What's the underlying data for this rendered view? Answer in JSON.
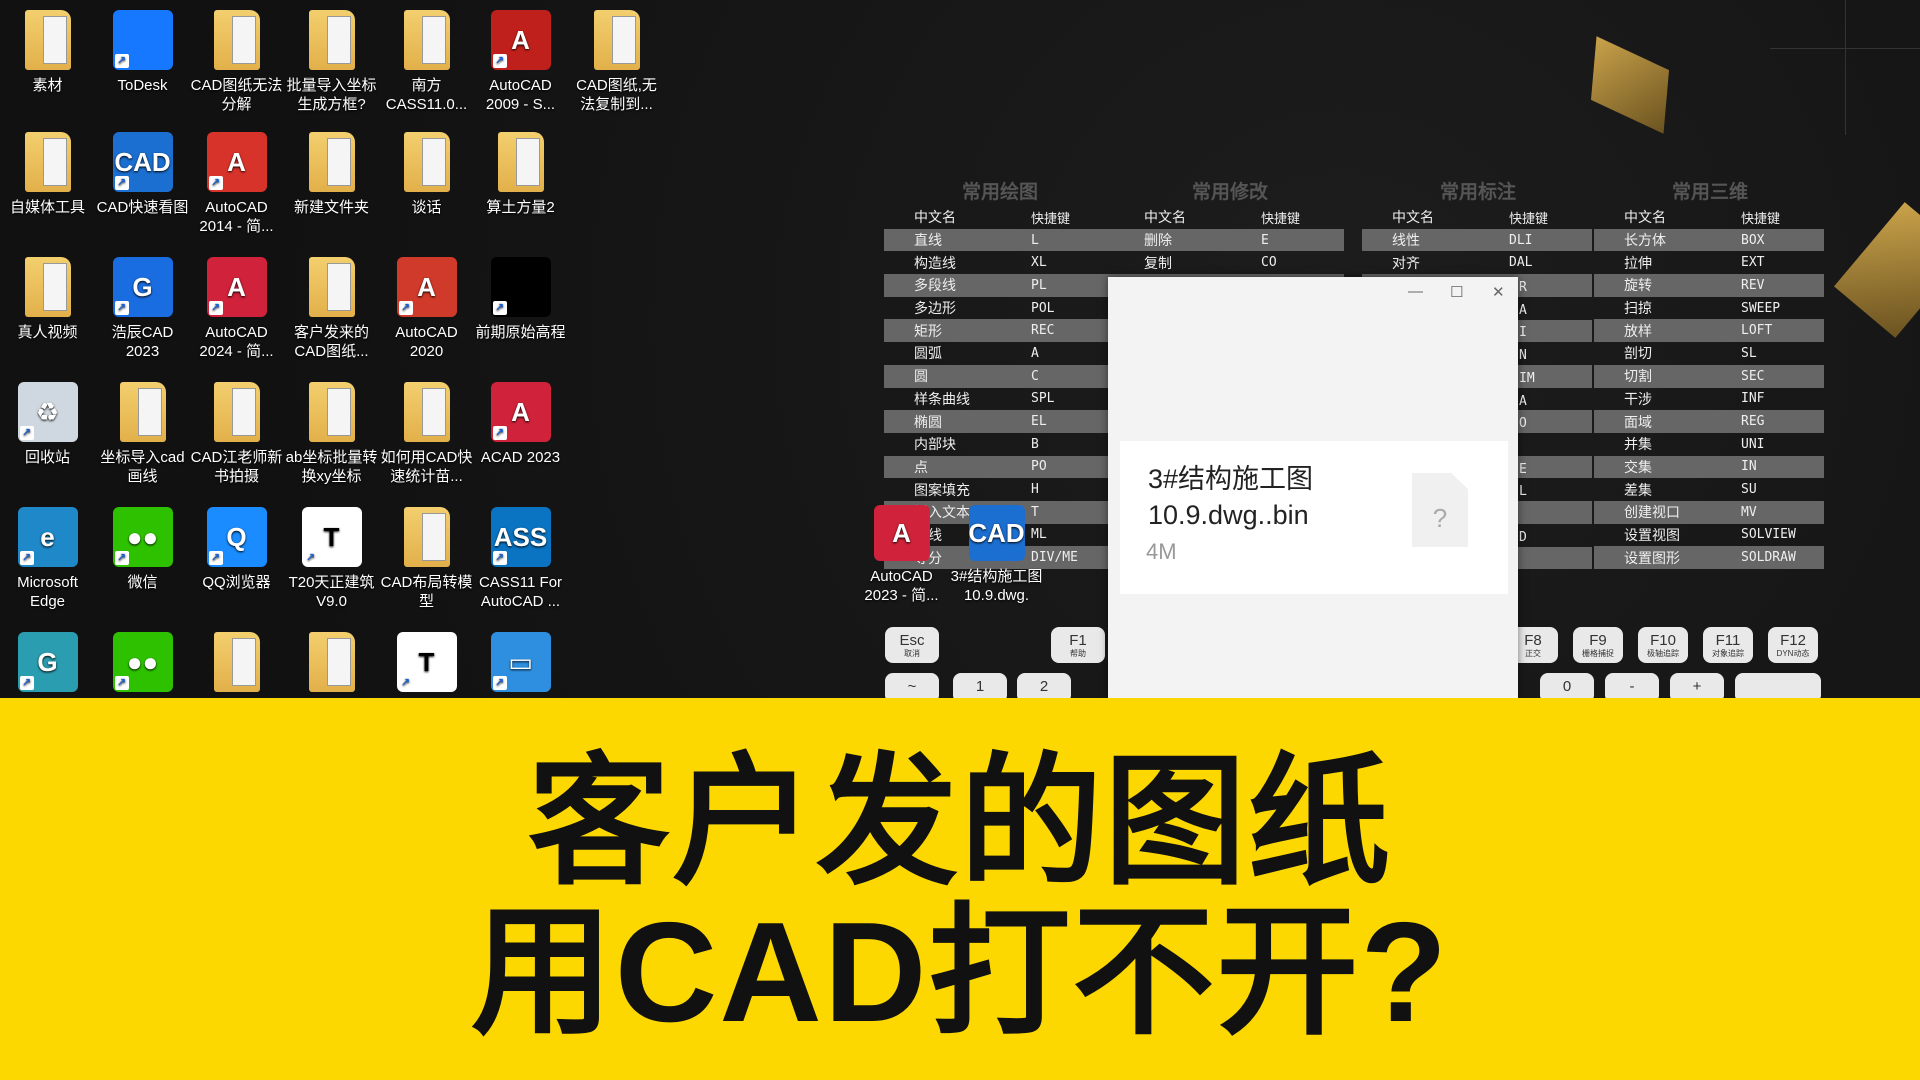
{
  "desktop_icons": [
    {
      "label": "素材",
      "type": "folder"
    },
    {
      "label": "ToDesk",
      "type": "app",
      "color": "#1677ff"
    },
    {
      "label": "CAD图纸无法分解",
      "type": "folder"
    },
    {
      "label": "批量导入坐标生成方框?",
      "type": "folder"
    },
    {
      "label": "南方CASS11.0...",
      "type": "folder"
    },
    {
      "label": "AutoCAD 2009 - S...",
      "type": "app",
      "color": "#c0201c",
      "glyph": "A"
    },
    {
      "label": "CAD图纸,无法复制到...",
      "type": "folder"
    },
    {
      "label": "自媒体工具",
      "type": "folder"
    },
    {
      "label": "CAD快速看图",
      "type": "app",
      "color": "#1b6fd1",
      "glyph": "CAD"
    },
    {
      "label": "AutoCAD 2014 - 简...",
      "type": "app",
      "color": "#d8332a",
      "glyph": "A"
    },
    {
      "label": "新建文件夹",
      "type": "folder"
    },
    {
      "label": "谈话",
      "type": "folder"
    },
    {
      "label": "算土方量2",
      "type": "folder"
    },
    {
      "label": "真人视频",
      "type": "folder"
    },
    {
      "label": "浩辰CAD 2023",
      "type": "app",
      "color": "#1a6de0",
      "glyph": "G"
    },
    {
      "label": "AutoCAD 2024 - 简...",
      "type": "app",
      "color": "#d0223a",
      "glyph": "A"
    },
    {
      "label": "客户发来的CAD图纸...",
      "type": "folder"
    },
    {
      "label": "AutoCAD 2020",
      "type": "app",
      "color": "#d03a2a",
      "glyph": "A"
    },
    {
      "label": "前期原始高程",
      "type": "app",
      "color": "#000",
      "glyph": ""
    },
    {
      "label": "回收站",
      "type": "app",
      "color": "#cfd8e0",
      "glyph": "♻"
    },
    {
      "label": "坐标导入cad画线",
      "type": "folder"
    },
    {
      "label": "CAD江老师新书拍摄",
      "type": "folder"
    },
    {
      "label": "ab坐标批量转换xy坐标",
      "type": "folder"
    },
    {
      "label": "如何用CAD快速统计苗...",
      "type": "folder"
    },
    {
      "label": "ACAD 2023",
      "type": "app",
      "color": "#d0223a",
      "glyph": "A"
    },
    {
      "label": "Microsoft Edge",
      "type": "app",
      "color": "#1e88c8",
      "glyph": "e"
    },
    {
      "label": "微信",
      "type": "app",
      "color": "#2dc100",
      "glyph": "●●"
    },
    {
      "label": "QQ浏览器",
      "type": "app",
      "color": "#1a8cff",
      "glyph": "Q"
    },
    {
      "label": "T20天正建筑V9.0",
      "type": "app",
      "color": "#fff",
      "glyph": "T"
    },
    {
      "label": "CAD布局转模型",
      "type": "folder"
    },
    {
      "label": "CASS11 For AutoCAD ...",
      "type": "app",
      "color": "#0a74c2",
      "glyph": "ASS"
    },
    {
      "label": "",
      "type": "app",
      "color": "#2a9db0",
      "glyph": "G"
    },
    {
      "label": "",
      "type": "app",
      "color": "#2dc100",
      "glyph": "●●"
    },
    {
      "label": "",
      "type": "folder"
    },
    {
      "label": "",
      "type": "folder"
    },
    {
      "label": "",
      "type": "app",
      "color": "#fff",
      "glyph": "T"
    },
    {
      "label": "",
      "type": "app",
      "color": "#2e8fe0",
      "glyph": "▭"
    }
  ],
  "overlay_icons": [
    {
      "label": "AutoCAD 2023 - 简...",
      "color": "#d0223a",
      "glyph": "A"
    },
    {
      "label": "3#结构施工图10.9.dwg.",
      "color": "#1b6fd1",
      "glyph": "CAD"
    }
  ],
  "cheatsheet": {
    "col_name": "中文名",
    "col_key": "快捷键",
    "groups": [
      {
        "title": "常用绘图",
        "rows": [
          [
            "直线",
            "L"
          ],
          [
            "构造线",
            "XL"
          ],
          [
            "多段线",
            "PL"
          ],
          [
            "多边形",
            "POL"
          ],
          [
            "矩形",
            "REC"
          ],
          [
            "圆弧",
            "A"
          ],
          [
            "圆",
            "C"
          ],
          [
            "样条曲线",
            "SPL"
          ],
          [
            "椭圆",
            "EL"
          ],
          [
            "内部块",
            "B"
          ],
          [
            "点",
            "PO"
          ],
          [
            "图案填充",
            "H"
          ],
          [
            "插入文本",
            "T"
          ],
          [
            "多线",
            "ML"
          ],
          [
            "等分",
            "DIV/ME"
          ]
        ]
      },
      {
        "title": "常用修改",
        "rows": [
          [
            "删除",
            "E"
          ],
          [
            "复制",
            "CO"
          ]
        ]
      },
      {
        "title": "常用标注",
        "rows": [
          [
            "线性",
            "DLI"
          ],
          [
            "对齐",
            "DAL"
          ]
        ],
        "visible_key_fragments": [
          "R",
          "A",
          "I",
          "N",
          "IM",
          "A",
          "O",
          "",
          "E",
          "L",
          "",
          "D",
          ""
        ]
      },
      {
        "title": "常用三维",
        "rows": [
          [
            "长方体",
            "BOX"
          ],
          [
            "拉伸",
            "EXT"
          ],
          [
            "旋转",
            "REV"
          ],
          [
            "扫掠",
            "SWEEP"
          ],
          [
            "放样",
            "LOFT"
          ],
          [
            "剖切",
            "SL"
          ],
          [
            "切割",
            "SEC"
          ],
          [
            "干涉",
            "INF"
          ],
          [
            "面域",
            "REG"
          ],
          [
            "并集",
            "UNI"
          ],
          [
            "交集",
            "IN"
          ],
          [
            "差集",
            "SU"
          ],
          [
            "创建视口",
            "MV"
          ],
          [
            "设置视图",
            "SOLVIEW"
          ],
          [
            "设置图形",
            "SOLDRAW"
          ]
        ]
      }
    ],
    "fkeys": [
      {
        "k": "Esc",
        "s": "取消"
      },
      {
        "k": "F1",
        "s": "帮助"
      },
      {
        "k": "F8",
        "s": "正交"
      },
      {
        "k": "F9",
        "s": "栅格捕捉"
      },
      {
        "k": "F10",
        "s": "极轴追踪"
      },
      {
        "k": "F11",
        "s": "对象追踪"
      },
      {
        "k": "F12",
        "s": "DYN动态"
      }
    ],
    "numkeys": [
      "~",
      "1",
      "2",
      "0",
      "-",
      "+",
      ""
    ]
  },
  "dialog": {
    "minimize": "—",
    "maximize": "☐",
    "close": "✕",
    "file_name_line1": "3#结构施工图",
    "file_name_line2": "10.9.dwg..bin",
    "file_size": "4M",
    "file_icon": "?"
  },
  "banner": {
    "line1": "客户发的图纸",
    "line2": "用CAD打不开?",
    "color": "#fcd800"
  }
}
